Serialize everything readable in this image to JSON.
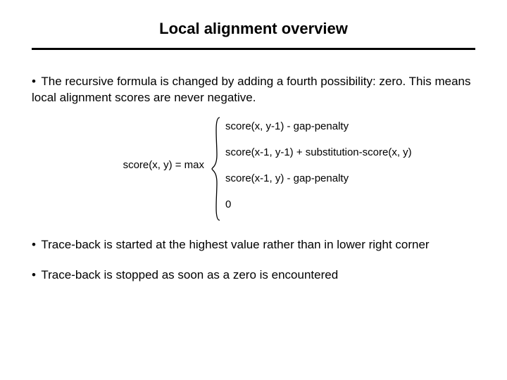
{
  "title": "Local alignment overview",
  "bullets": {
    "b1": "The recursive formula is changed by adding a fourth possibility: zero. This means local alignment scores are never negative.",
    "b2": "Trace-back is started at the highest value rather than in lower right corner",
    "b3": "Trace-back is stopped as soon as a zero is encountered"
  },
  "formula": {
    "lhs": "score(x, y) = max",
    "options": {
      "o1": "score(x, y-1) - gap-penalty",
      "o2": "score(x-1, y-1) + substitution-score(x, y)",
      "o3": "score(x-1, y) - gap-penalty",
      "o4": "0"
    }
  }
}
